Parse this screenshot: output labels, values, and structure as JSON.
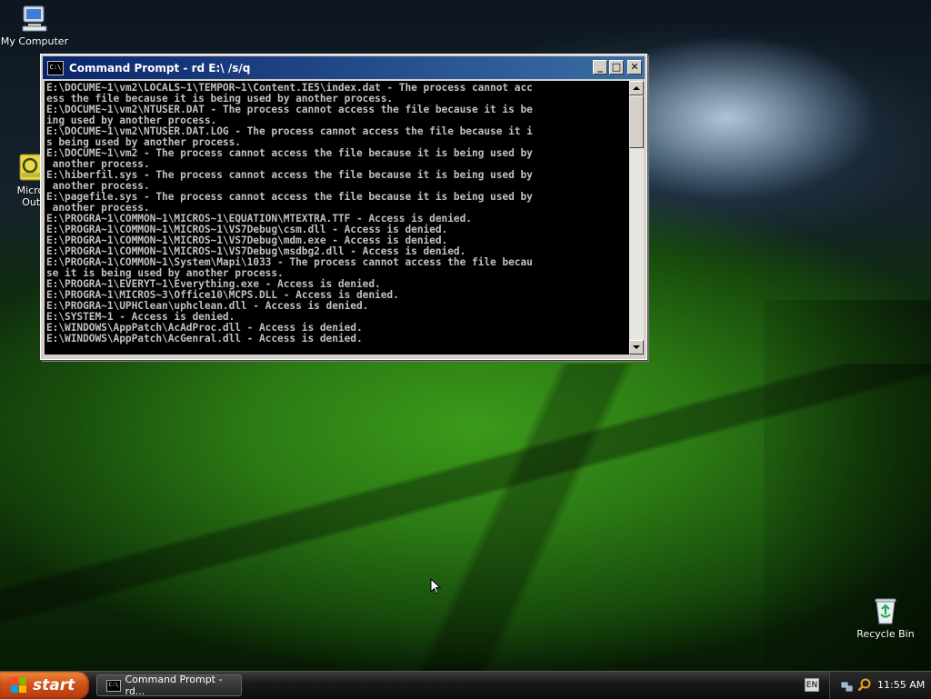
{
  "desktop": {
    "icons": [
      {
        "label": "My Computer",
        "icon": "my-computer-icon"
      },
      {
        "label": "Micros\nOutlo",
        "icon": "outlook-icon"
      },
      {
        "label": "Recycle Bin",
        "icon": "recycle-bin-icon"
      }
    ]
  },
  "window": {
    "title": "Command Prompt - rd E:\\ /s/q",
    "icon_label": "C:\\",
    "buttons": {
      "minimize": "_",
      "maximize": "□",
      "close": "✕"
    },
    "console_lines": [
      "E:\\DOCUME~1\\vm2\\LOCALS~1\\TEMPOR~1\\Content.IE5\\index.dat - The process cannot acc",
      "ess the file because it is being used by another process.",
      "E:\\DOCUME~1\\vm2\\NTUSER.DAT - The process cannot access the file because it is be",
      "ing used by another process.",
      "E:\\DOCUME~1\\vm2\\NTUSER.DAT.LOG - The process cannot access the file because it i",
      "s being used by another process.",
      "E:\\DOCUME~1\\vm2 - The process cannot access the file because it is being used by",
      " another process.",
      "E:\\hiberfil.sys - The process cannot access the file because it is being used by",
      " another process.",
      "E:\\pagefile.sys - The process cannot access the file because it is being used by",
      " another process.",
      "E:\\PROGRA~1\\COMMON~1\\MICROS~1\\EQUATION\\MTEXTRA.TTF - Access is denied.",
      "E:\\PROGRA~1\\COMMON~1\\MICROS~1\\VS7Debug\\csm.dll - Access is denied.",
      "E:\\PROGRA~1\\COMMON~1\\MICROS~1\\VS7Debug\\mdm.exe - Access is denied.",
      "E:\\PROGRA~1\\COMMON~1\\MICROS~1\\VS7Debug\\msdbg2.dll - Access is denied.",
      "E:\\PROGRA~1\\COMMON~1\\System\\Mapi\\1033 - The process cannot access the file becau",
      "se it is being used by another process.",
      "E:\\PROGRA~1\\EVERYT~1\\Everything.exe - Access is denied.",
      "E:\\PROGRA~1\\MICROS~3\\Office10\\MCPS.DLL - Access is denied.",
      "E:\\PROGRA~1\\UPHClean\\uphclean.dll - Access is denied.",
      "E:\\SYSTEM~1 - Access is denied.",
      "E:\\WINDOWS\\AppPatch\\AcAdProc.dll - Access is denied.",
      "E:\\WINDOWS\\AppPatch\\AcGenral.dll - Access is denied."
    ]
  },
  "taskbar": {
    "start_label": "start",
    "task_label": "Command Prompt - rd...",
    "task_icon_label": "C:\\",
    "language": "EN",
    "clock": "11:55 AM"
  }
}
